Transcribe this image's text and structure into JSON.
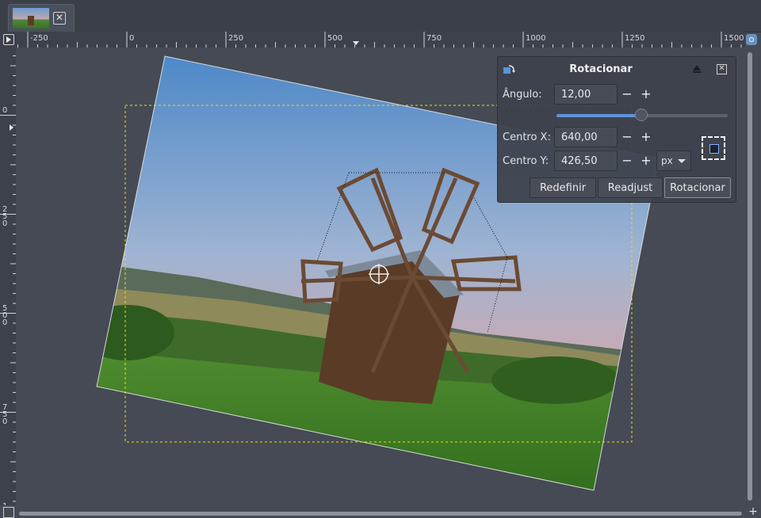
{
  "tab": {
    "close_icon": "close-icon"
  },
  "ruler": {
    "horizontal_labels": [
      "-250",
      "0",
      "250",
      "500",
      "750",
      "1000",
      "1250",
      "1500"
    ],
    "vertical_labels": [
      "0",
      "250",
      "500",
      "750",
      "1"
    ]
  },
  "dialog": {
    "title": "Rotacionar",
    "angle_label": "Ângulo:",
    "angle_value": "12,00",
    "angle_fraction": 0.495,
    "center_x_label": "Centro X:",
    "center_x_value": "640,00",
    "center_y_label": "Centro Y:",
    "center_y_value": "426,50",
    "unit": "px",
    "minus": "−",
    "plus": "+",
    "reset_label": "Redefinir",
    "readjust_label": "Readjust",
    "rotate_label": "Rotacionar"
  },
  "colors": {
    "selection": "#f0e000",
    "accent": "#5d93d8"
  }
}
